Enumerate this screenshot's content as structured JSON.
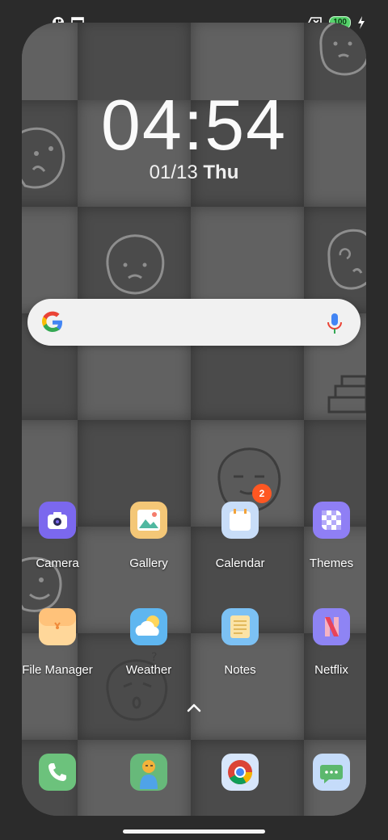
{
  "status_bar": {
    "left_icons": [
      "app-notification-icon",
      "screenshot-icon"
    ],
    "right_icons": [
      "no-sim-icon",
      "battery-icon",
      "charging-bolt-icon"
    ],
    "battery_level": "100"
  },
  "lockscreen": {
    "time": "04:54",
    "date": "01/13",
    "day": "Thu"
  },
  "search_bar": {
    "left_icon": "google-g-icon",
    "right_icon": "microphone-icon"
  },
  "apps": [
    {
      "label": "Camera",
      "icon": "camera-icon",
      "color": "#7b68ee"
    },
    {
      "label": "Gallery",
      "icon": "gallery-icon",
      "color": "#f4c777"
    },
    {
      "label": "Calendar",
      "icon": "calendar-icon",
      "color": "#c8ddf8",
      "badge": "2"
    },
    {
      "label": "Themes",
      "icon": "themes-icon",
      "color": "#8f7ff5"
    },
    {
      "label": "File Manager",
      "icon": "folder-icon",
      "color": "#ffd79a"
    },
    {
      "label": "Weather",
      "icon": "weather-icon",
      "color": "#5fb6f0"
    },
    {
      "label": "Notes",
      "icon": "notes-icon",
      "color": "#7cc1f4"
    },
    {
      "label": "Netflix",
      "icon": "netflix-icon",
      "color": "#8e84f4"
    }
  ],
  "app_drawer": {
    "icon": "chevron-up-icon"
  },
  "dock": [
    {
      "icon": "phone-icon",
      "color": "#6cc27c"
    },
    {
      "icon": "contacts-icon",
      "color": "#67b97a"
    },
    {
      "icon": "chrome-icon",
      "color": "#d7e6fb"
    },
    {
      "icon": "messages-icon",
      "color": "#c5dcfa"
    }
  ]
}
